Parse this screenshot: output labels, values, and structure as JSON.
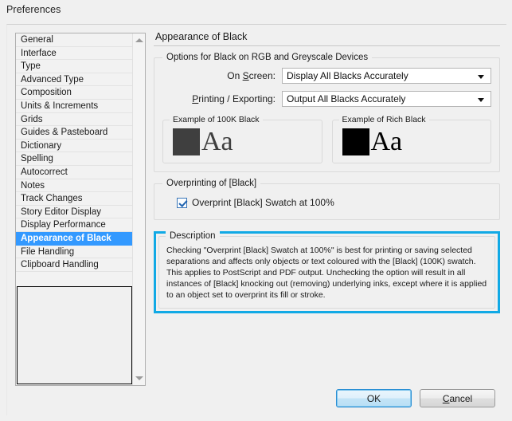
{
  "window": {
    "title": "Preferences"
  },
  "sidebar": {
    "items": [
      {
        "label": "General",
        "selected": false
      },
      {
        "label": "Interface",
        "selected": false
      },
      {
        "label": "Type",
        "selected": false
      },
      {
        "label": "Advanced Type",
        "selected": false
      },
      {
        "label": "Composition",
        "selected": false
      },
      {
        "label": "Units & Increments",
        "selected": false
      },
      {
        "label": "Grids",
        "selected": false
      },
      {
        "label": "Guides & Pasteboard",
        "selected": false
      },
      {
        "label": "Dictionary",
        "selected": false
      },
      {
        "label": "Spelling",
        "selected": false
      },
      {
        "label": "Autocorrect",
        "selected": false
      },
      {
        "label": "Notes",
        "selected": false
      },
      {
        "label": "Track Changes",
        "selected": false
      },
      {
        "label": "Story Editor Display",
        "selected": false
      },
      {
        "label": "Display Performance",
        "selected": false
      },
      {
        "label": "Appearance of Black",
        "selected": true
      },
      {
        "label": "File Handling",
        "selected": false
      },
      {
        "label": "Clipboard Handling",
        "selected": false
      }
    ],
    "scroll_up_icon": "scroll-up-arrow-icon",
    "scroll_down_icon": "scroll-down-arrow-icon"
  },
  "main": {
    "page_title": "Appearance of Black",
    "options_group": {
      "legend": "Options for Black on RGB and Greyscale Devices",
      "fields": [
        {
          "label_prefix": "On ",
          "label_accel": "S",
          "label_suffix": "creen:",
          "value": "Display All Blacks Accurately"
        },
        {
          "label_prefix": "",
          "label_accel": "P",
          "label_suffix": "rinting / Exporting:",
          "value": "Output All Blacks Accurately"
        }
      ],
      "examples": [
        {
          "legend": "Example of 100K Black",
          "sample_text": "Aa",
          "swatch_color": "#3f3f3f"
        },
        {
          "legend": "Example of Rich Black",
          "sample_text": "Aa",
          "swatch_color": "#000000"
        }
      ]
    },
    "overprint_group": {
      "legend": "Overprinting of [Black]",
      "checkbox_label": "Overprint [Black] Swatch at 100%",
      "checkbox_checked": true
    },
    "description_group": {
      "legend": "Description",
      "text": "Checking \"Overprint [Black] Swatch at 100%\" is best for printing or saving selected separations and affects only objects or text coloured with the [Black] (100K) swatch. This applies to PostScript and PDF output. Unchecking the option will result in all instances of [Black] knocking out (removing) underlying inks, except where it is applied to an object set to overprint its fill or stroke.",
      "highlight_color": "#11a9e5"
    }
  },
  "buttons": {
    "ok": "OK",
    "cancel_prefix": "",
    "cancel_accel": "C",
    "cancel_suffix": "ancel"
  },
  "colors": {
    "selection_blue": "#3399ff",
    "highlight_cyan": "#11a9e5",
    "dialog_bg": "#f0f0f0"
  }
}
